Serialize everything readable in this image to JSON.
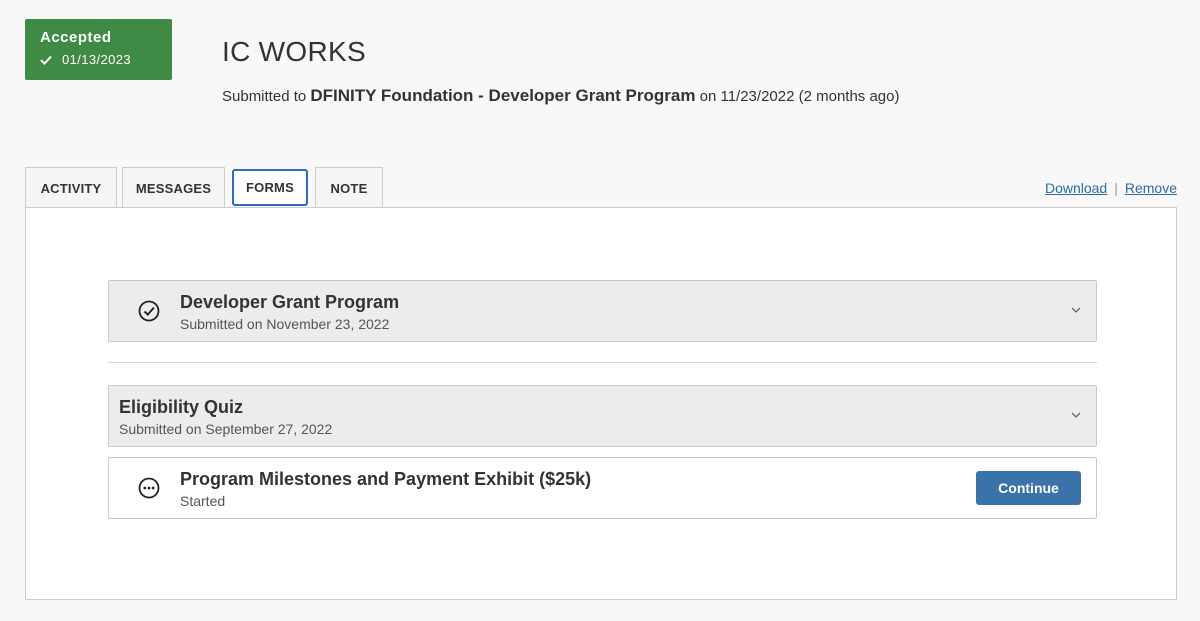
{
  "status": {
    "label": "Accepted",
    "date": "01/13/2023",
    "color": "#3f8a45"
  },
  "header": {
    "title": "IC WORKS",
    "submitted_prefix": "Submitted to ",
    "program": "DFINITY Foundation - Developer Grant Program",
    "submitted_suffix": " on 11/23/2022 (2 months ago)"
  },
  "tabs": [
    {
      "label": "ACTIVITY"
    },
    {
      "label": "MESSAGES"
    },
    {
      "label": "FORMS"
    },
    {
      "label": "NOTE"
    }
  ],
  "links": {
    "download": "Download",
    "separator": "|",
    "remove": "Remove"
  },
  "forms": [
    {
      "title": "Developer Grant Program",
      "subtitle": "Submitted on November 23, 2022",
      "icon": "check-circle-icon"
    },
    {
      "title": "Eligibility Quiz",
      "subtitle": "Submitted on September 27, 2022"
    },
    {
      "title": "Program Milestones and Payment Exhibit ($25k)",
      "subtitle": "Started",
      "icon": "ellipsis-circle-icon",
      "action": "Continue"
    }
  ],
  "colors": {
    "accent": "#2b6cc4",
    "button": "#3a73aa",
    "link": "#2b6ca7"
  }
}
